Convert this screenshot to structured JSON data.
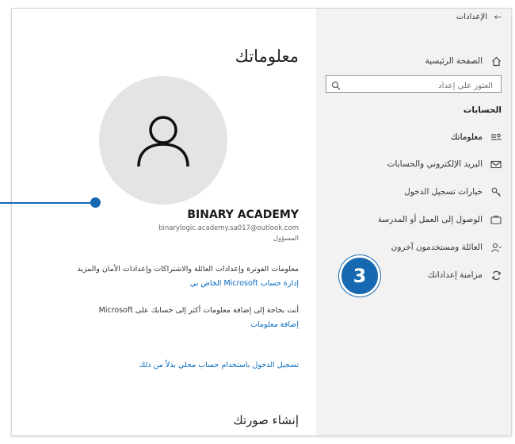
{
  "window": {
    "title": "الإعدادات"
  },
  "sidebar": {
    "home_label": "الصفحة الرئيسية",
    "search_placeholder": "العثور على إعداد",
    "section_heading": "الحسابات",
    "items": [
      {
        "label": "معلوماتك",
        "icon": "person-card-icon"
      },
      {
        "label": "البريد الإلكتروني والحسابات",
        "icon": "mail-icon"
      },
      {
        "label": "خيارات تسجيل الدخول",
        "icon": "key-icon"
      },
      {
        "label": "الوصول إلى العمل أو المدرسة",
        "icon": "briefcase-icon"
      },
      {
        "label": "العائلة ومستخدمون آخرون",
        "icon": "family-icon"
      },
      {
        "label": "مزامنة إعداداتك",
        "icon": "sync-icon"
      }
    ]
  },
  "main": {
    "title": "معلوماتك",
    "account_name": "BINARY ACADEMY",
    "account_email": "binarylogic.academy.sa017@outlook.com",
    "account_role": "المسؤول",
    "billing_text": "معلومات الفوترة وإعدادات العائلة والاشتراكات وإعدادات الأمان والمزيد",
    "manage_link": "إدارة حساب Microsoft الخاص بي",
    "add_info_text": "أنت بحاجة إلى إضافة معلومات أكثر إلى حسابك على Microsoft",
    "add_info_link": "إضافة معلومات",
    "local_signin_link": "تسجيل الدخول باستخدام حساب محلي بدلاً من ذلك",
    "create_picture_title": "إنشاء صورتك"
  },
  "overlay": {
    "step_number": "3"
  },
  "colors": {
    "accent": "#1669b0",
    "link": "#0067c0",
    "sidebar_bg": "#f2f2f2",
    "avatar_bg": "#e4e4e4"
  }
}
